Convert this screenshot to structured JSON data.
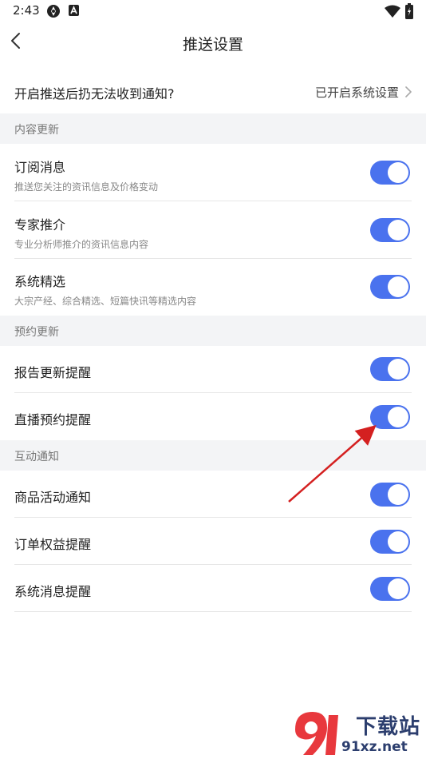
{
  "status_bar": {
    "time": "2:43",
    "icons": [
      "compass-icon",
      "a-square-icon",
      "wifi-icon",
      "battery-icon"
    ]
  },
  "header": {
    "title": "推送设置",
    "back_icon": "chevron-left-icon"
  },
  "notice": {
    "text": "开启推送后扔无法收到通知?",
    "status": "已开启系统设置",
    "chevron_icon": "chevron-right-icon"
  },
  "sections": [
    {
      "label": "内容更新",
      "items": [
        {
          "title": "订阅消息",
          "subtitle": "推送您关注的资讯信息及价格变动",
          "enabled": true
        },
        {
          "title": "专家推介",
          "subtitle": "专业分析师推介的资讯信息内容",
          "enabled": true
        },
        {
          "title": "系统精选",
          "subtitle": "大宗产经、综合精选、短篇快讯等精选内容",
          "enabled": true
        }
      ]
    },
    {
      "label": "预约更新",
      "items": [
        {
          "title": "报告更新提醒",
          "enabled": true
        },
        {
          "title": "直播预约提醒",
          "enabled": true
        }
      ]
    },
    {
      "label": "互动通知",
      "items": [
        {
          "title": "商品活动通知",
          "enabled": true
        },
        {
          "title": "订单权益提醒",
          "enabled": true
        },
        {
          "title": "系统消息提醒",
          "enabled": true
        }
      ]
    }
  ],
  "colors": {
    "toggle_on": "#4a72ee",
    "section_bg": "#f3f4f6",
    "annotation_arrow": "#d42020"
  },
  "watermark": {
    "top": "下载站",
    "bottom": "91xz.net"
  }
}
